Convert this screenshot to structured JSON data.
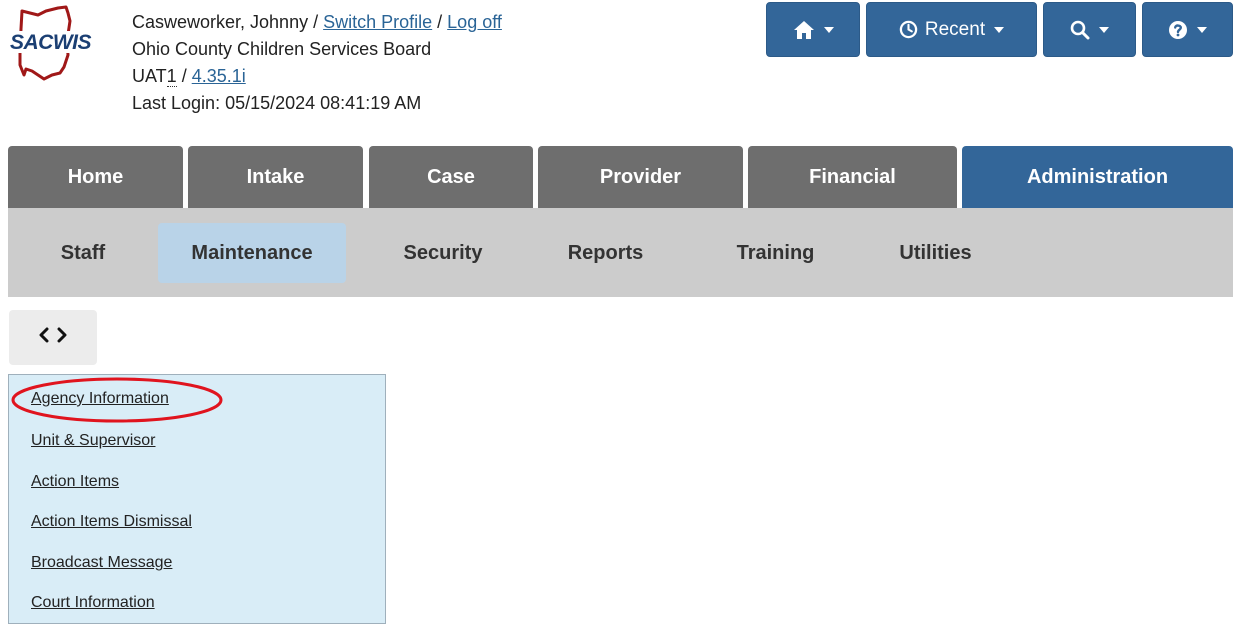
{
  "header": {
    "user_name": "Casweworker, Johnny",
    "separator": " / ",
    "switch_profile": "Switch Profile",
    "log_off": "Log off",
    "agency": "Ohio County Children Services Board",
    "env_prefix": "UAT",
    "env_suffix": "1",
    "version": "4.35.1i",
    "last_login": "Last Login: 05/15/2024 08:41:19 AM",
    "logo_text": "SACWIS"
  },
  "toolbar": {
    "home_icon": "home-icon",
    "recent_label": "Recent",
    "recent_icon": "clock-icon",
    "search_icon": "search-icon",
    "help_icon": "help-icon"
  },
  "main_tabs": [
    {
      "label": "Home"
    },
    {
      "label": "Intake"
    },
    {
      "label": "Case"
    },
    {
      "label": "Provider"
    },
    {
      "label": "Financial"
    },
    {
      "label": "Administration",
      "active": true
    }
  ],
  "sub_tabs": [
    {
      "label": "Staff"
    },
    {
      "label": "Maintenance",
      "active": true
    },
    {
      "label": "Security"
    },
    {
      "label": "Reports"
    },
    {
      "label": "Training"
    },
    {
      "label": "Utilities"
    }
  ],
  "menu": {
    "items": [
      {
        "label": "Agency Information",
        "highlighted": true
      },
      {
        "label": "Unit & Supervisor"
      },
      {
        "label": "Action Items"
      },
      {
        "label": "Action Items Dismissal"
      },
      {
        "label": "Broadcast Message"
      },
      {
        "label": "Court Information"
      }
    ]
  },
  "colors": {
    "brand_blue": "#336699",
    "tab_gray": "#6e6e6e",
    "subnav_gray": "#cccccc",
    "subtab_active": "#b9d3e8",
    "menu_bg": "#d9edf7",
    "highlight_red": "#e0141e"
  }
}
